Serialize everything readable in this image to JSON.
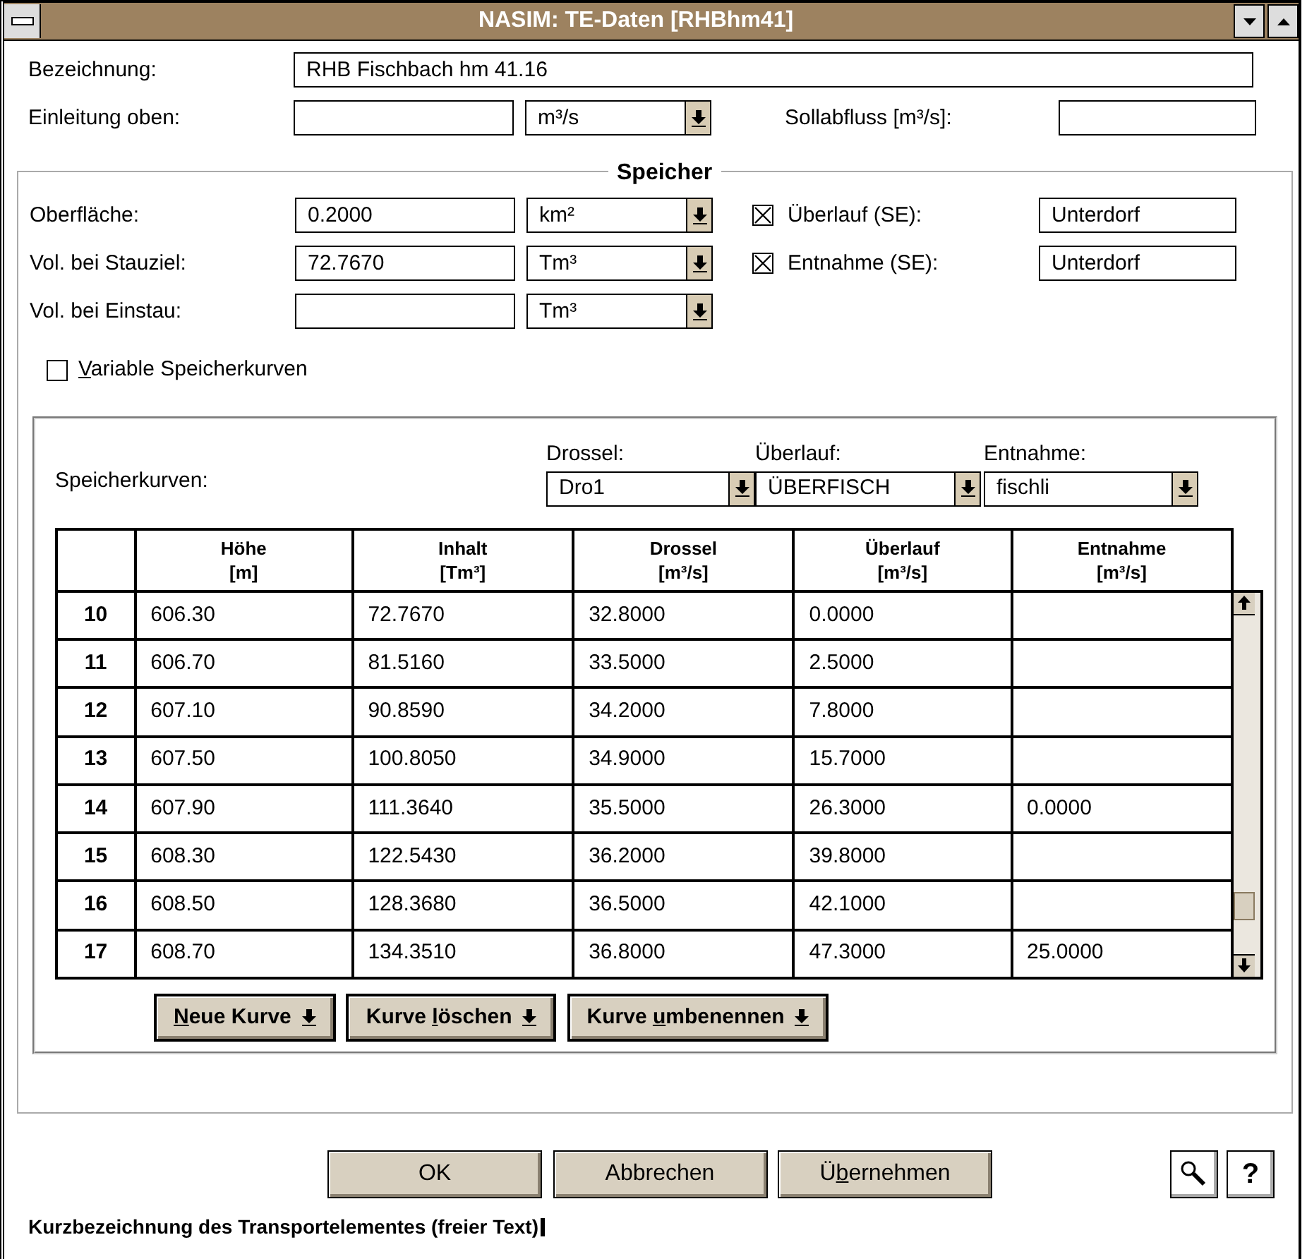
{
  "window": {
    "title": "NASIM: TE-Daten [RHBhm41]"
  },
  "general": {
    "bezeichnung": {
      "label": "Bezeichnung:",
      "value": "RHB Fischbach hm 41.16"
    },
    "einleitung": {
      "label": "Einleitung oben:",
      "unit": "m³/s"
    },
    "sollabfluss": {
      "label": "Sollabfluss [m³/s]:"
    }
  },
  "speicher": {
    "title": "Speicher",
    "rows": [
      {
        "label": "Oberfläche:",
        "value": "0.2000",
        "unit": "km²"
      },
      {
        "label": "Vol. bei Stauziel:",
        "value": "72.7670",
        "unit": "Tm³"
      },
      {
        "label": "Vol. bei Einstau:",
        "unit": "Tm³"
      }
    ],
    "options": [
      {
        "label": "Überlauf (SE):",
        "checked": true,
        "value": "Unterdorf"
      },
      {
        "label": "Entnahme (SE):",
        "checked": true,
        "value": "Unterdorf"
      }
    ],
    "variable": {
      "label": {
        "key": "V",
        "post": "ariable Speicherkurven"
      },
      "checked": false
    }
  },
  "kurven": {
    "label": "Speicherkurven:",
    "selectors": [
      {
        "label": "Drossel:",
        "value": "Dro1"
      },
      {
        "label": "Überlauf:",
        "value": "ÜBERFISCH"
      },
      {
        "label": "Entnahme:",
        "value": "fischli"
      }
    ],
    "columns": [
      {
        "name": "Höhe",
        "unit": "[m]"
      },
      {
        "name": "Inhalt",
        "unit": "[Tm³]"
      },
      {
        "name": "Drossel",
        "unit": "[m³/s]"
      },
      {
        "name": "Überlauf",
        "unit": "[m³/s]"
      },
      {
        "name": "Entnahme",
        "unit": "[m³/s]"
      }
    ],
    "rows": [
      {
        "number": "10",
        "cells": [
          "606.30",
          "72.7670",
          "32.8000",
          "0.0000",
          null
        ]
      },
      {
        "number": "11",
        "cells": [
          "606.70",
          "81.5160",
          "33.5000",
          "2.5000",
          null
        ]
      },
      {
        "number": "12",
        "cells": [
          "607.10",
          "90.8590",
          "34.2000",
          "7.8000",
          null
        ]
      },
      {
        "number": "13",
        "cells": [
          "607.50",
          "100.8050",
          "34.9000",
          "15.7000",
          null
        ]
      },
      {
        "number": "14",
        "cells": [
          "607.90",
          "111.3640",
          "35.5000",
          "26.3000",
          "0.0000"
        ]
      },
      {
        "number": "15",
        "cells": [
          "608.30",
          "122.5430",
          "36.2000",
          "39.8000",
          null
        ]
      },
      {
        "number": "16",
        "cells": [
          "608.50",
          "128.3680",
          "36.5000",
          "42.1000",
          null
        ]
      },
      {
        "number": "17",
        "cells": [
          "608.70",
          "134.3510",
          "36.8000",
          "47.3000",
          "25.0000"
        ]
      }
    ],
    "buttons": [
      {
        "label": {
          "key": "N",
          "post": "eue Kurve"
        }
      },
      {
        "label": {
          "pre": "Kurve ",
          "key": "l",
          "post": "öschen"
        }
      },
      {
        "label": {
          "pre": "Kurve ",
          "key": "u",
          "post": "mbenennen"
        }
      }
    ]
  },
  "footer": {
    "buttons": [
      {
        "label": {
          "post": "OK"
        }
      },
      {
        "label": {
          "post": "Abbrechen"
        }
      },
      {
        "label": {
          "pre": "Ü",
          "key": "b",
          "post": "ernehmen"
        }
      }
    ],
    "help": "?",
    "status": "Kurzbezeichnung des Transportelementes (freier Text)"
  }
}
